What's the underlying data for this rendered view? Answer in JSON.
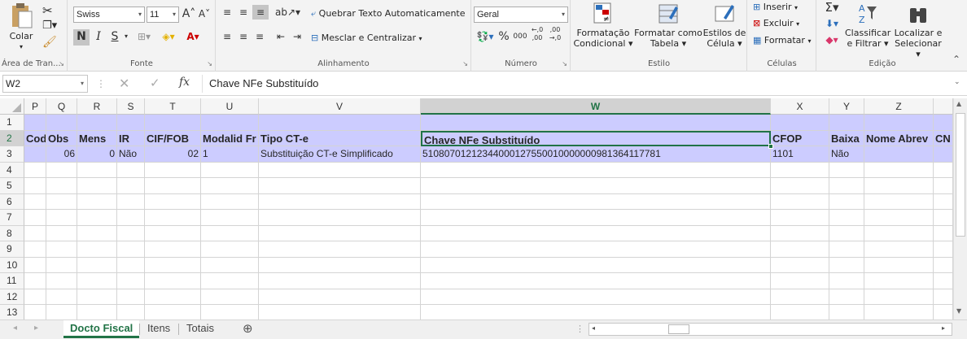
{
  "ribbon": {
    "clipboard": {
      "paste": "Colar",
      "group": "Área de Tran..."
    },
    "font": {
      "name": "Swiss",
      "size": "11",
      "bold": "N",
      "italic": "I",
      "underline": "S",
      "group": "Fonte"
    },
    "alignment": {
      "wrap": "Quebrar Texto Automaticamente",
      "merge": "Mesclar e Centralizar",
      "group": "Alinhamento"
    },
    "number": {
      "format": "Geral",
      "percent": "%",
      "thousands": "000",
      "inc": "←,0 ,00",
      "dec": ",00 →,0",
      "group": "Número"
    },
    "styles": {
      "cond1": "Formatação",
      "cond2": "Condicional",
      "table1": "Formatar como",
      "table2": "Tabela",
      "cell1": "Estilos de",
      "cell2": "Célula",
      "group": "Estilo"
    },
    "cells": {
      "insert": "Inserir",
      "delete": "Excluir",
      "format": "Formatar",
      "group": "Células"
    },
    "editing": {
      "sort1": "Classificar",
      "sort2": "e Filtrar",
      "find1": "Localizar e",
      "find2": "Selecionar",
      "group": "Edição"
    }
  },
  "formula_bar": {
    "name_box": "W2",
    "fx": "fx",
    "content": "Chave NFe Substituído"
  },
  "columns": [
    {
      "id": "P"
    },
    {
      "id": "Q"
    },
    {
      "id": "R"
    },
    {
      "id": "S"
    },
    {
      "id": "T"
    },
    {
      "id": "U"
    },
    {
      "id": "V"
    },
    {
      "id": "W"
    },
    {
      "id": "X"
    },
    {
      "id": "Y"
    },
    {
      "id": "Z"
    },
    {
      "id": ""
    }
  ],
  "rows": [
    "1",
    "2",
    "3",
    "4",
    "5",
    "6",
    "7",
    "8",
    "9",
    "10",
    "11",
    "12",
    "13"
  ],
  "header_row": [
    "Cod",
    "Obs",
    "Mens",
    "IR",
    "CIF/FOB",
    "Modalid Fr",
    "Tipo CT-e",
    "Chave NFe Substituído",
    "CFOP",
    "Baixa",
    "Nome Abrev",
    "CN"
  ],
  "data_row": [
    "",
    "06",
    "0",
    "Não",
    "02",
    "1",
    "Substituição CT-e Simplificado",
    "51080701212344000127550010000000981364117781",
    "1101",
    "Não",
    "",
    ""
  ],
  "sheets": [
    "Docto Fiscal",
    "Itens",
    "Totais"
  ],
  "active_sheet": "Docto Fiscal",
  "colors": {
    "accent": "#217346",
    "header_band": "#ccccff"
  }
}
